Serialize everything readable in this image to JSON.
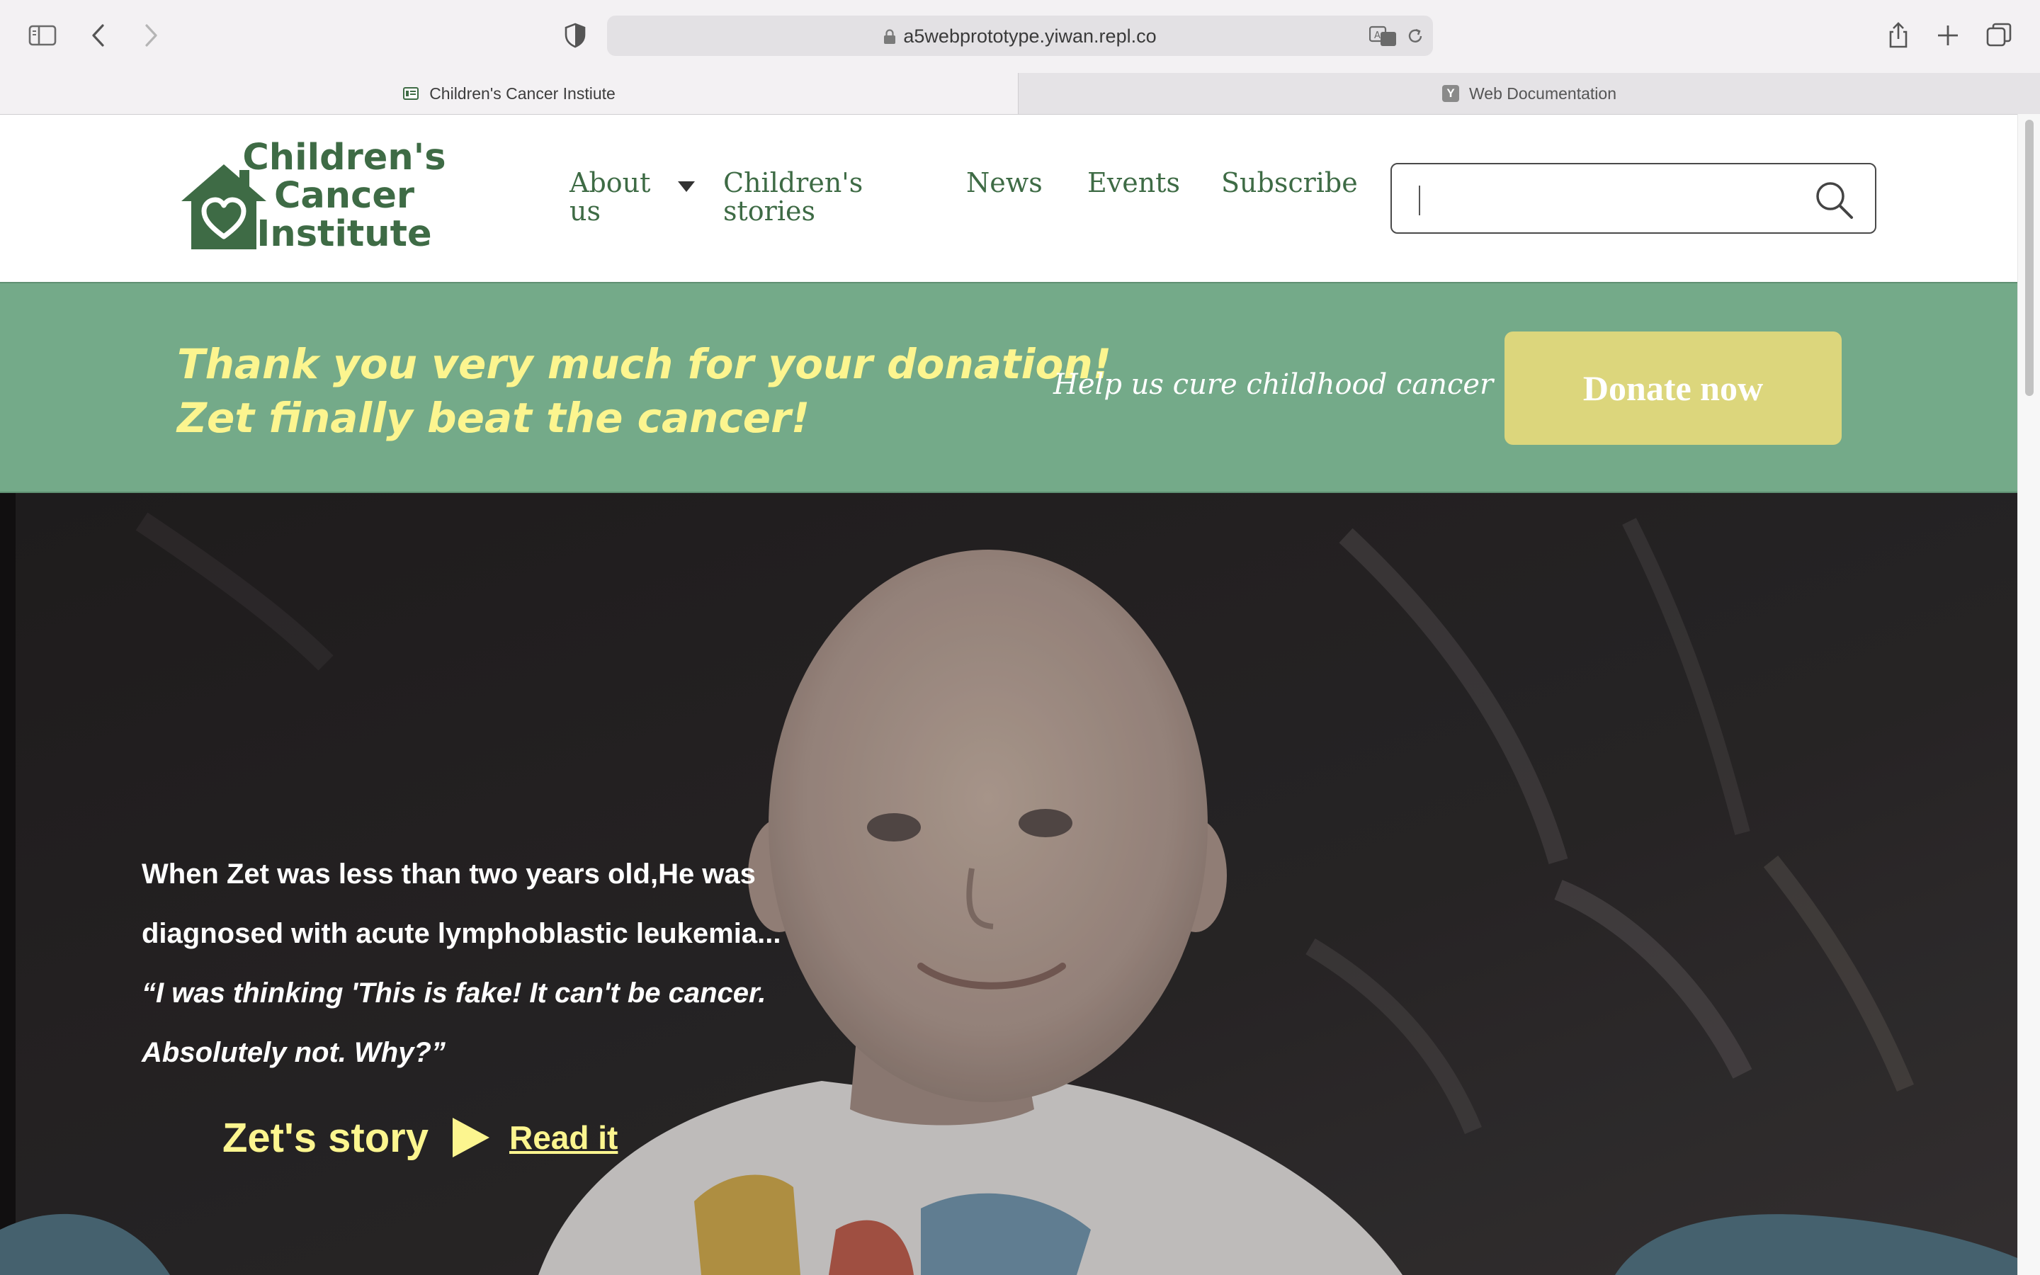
{
  "browser": {
    "url": "a5webprototype.yiwan.repl.co",
    "tabs": [
      {
        "label": "Children's Cancer Instiute",
        "active": true
      },
      {
        "label": "Web Documentation",
        "active": false,
        "favicon_letter": "Y"
      }
    ],
    "icons": [
      "sidebar-icon",
      "back-icon",
      "forward-icon",
      "shield-icon",
      "lock-icon",
      "translate-icon",
      "reload-icon",
      "share-icon",
      "new-tab-icon",
      "tab-overview-icon"
    ]
  },
  "site": {
    "logo": {
      "line1": "Children's",
      "line2": "Cancer",
      "line3": "Institute",
      "icon": "house-heart-icon"
    },
    "nav": {
      "about_line1": "About",
      "about_line2": "us",
      "stories_line1": "Children's",
      "stories_line2": "stories",
      "news": "News",
      "events": "Events",
      "subscribe": "Subscribe"
    },
    "search": {
      "placeholder": "",
      "icon": "search-icon"
    }
  },
  "banner": {
    "thanks_line1": "Thank you very much for your donation!",
    "thanks_line2": "Zet finally beat the cancer!",
    "help_text": "Help us cure childhood cancer",
    "donate_label": "Donate now"
  },
  "hero": {
    "line1": "When Zet was less than two years old,He was",
    "line2": "diagnosed with acute lymphoblastic leukemia...",
    "quote_line1": "“I was thinking 'This is fake! It can't be cancer.",
    "quote_line2": "Absolutely not. Why?”",
    "story_title": "Zet's story",
    "read_link": "Read it"
  },
  "colors": {
    "brand_green": "#3e6b45",
    "banner_green": "#74aa89",
    "accent_yellow": "#fcf58f",
    "donate_button": "#dcd67c"
  }
}
